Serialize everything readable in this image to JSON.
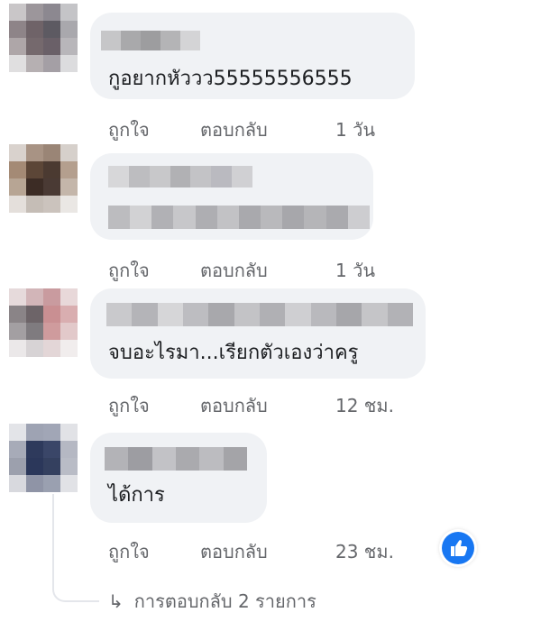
{
  "comments": [
    {
      "text": "กูอยากหัววว55555556555",
      "like_label": "ถูกใจ",
      "reply_label": "ตอบกลับ",
      "time": "1 วัน"
    },
    {
      "text": "",
      "like_label": "ถูกใจ",
      "reply_label": "ตอบกลับ",
      "time": "1 วัน"
    },
    {
      "text": "จบอะไรมา...เรียกตัวเองว่าครู",
      "like_label": "ถูกใจ",
      "reply_label": "ตอบกลับ",
      "time": "12 ชม."
    },
    {
      "text": "ได้การ",
      "like_label": "ถูกใจ",
      "reply_label": "ตอบกลับ",
      "time": "23 ชม."
    }
  ],
  "reactions": {
    "icon": "thumbs-up-icon",
    "color": "#1877f2"
  },
  "replies_link": {
    "arrow_icon": "reply-arrow-icon",
    "label": "การตอบกลับ 2 รายการ"
  },
  "colors": {
    "bubble": "#f0f2f5",
    "meta_text": "#65676b",
    "text": "#1c1e21"
  }
}
